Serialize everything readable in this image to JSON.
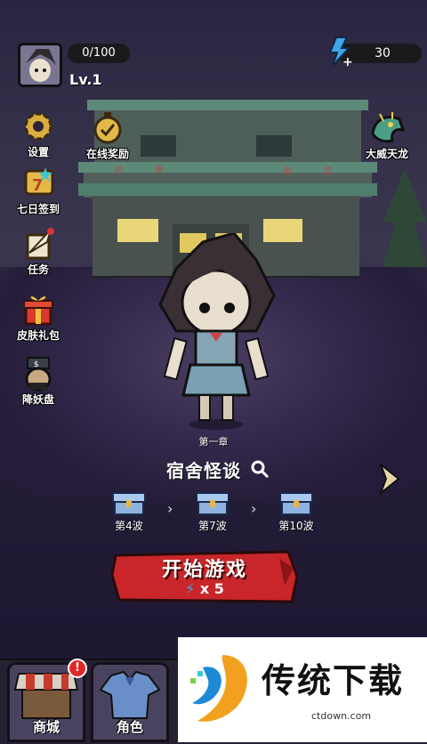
{
  "player": {
    "xp": "0/100",
    "level": "Lv.1"
  },
  "energy": {
    "value": "30"
  },
  "side_menu": {
    "settings": "设置",
    "checkin": "七日签到",
    "tasks": "任务",
    "skin_pack": "皮肤礼包",
    "demon_wheel": "降妖盘",
    "online_reward": "在线奖励",
    "dragon": "大威天龙"
  },
  "chapter": {
    "number": "第一章",
    "title": "宿舍怪谈",
    "waves": [
      "第4波",
      "第7波",
      "第10波"
    ]
  },
  "start_button": {
    "label": "开始游戏",
    "cost": "x 5"
  },
  "bottom_tabs": {
    "shop": "商城",
    "character": "角色",
    "shop_badge": "!"
  },
  "watermark": {
    "name": "传统下载",
    "url": "ctdown.com"
  },
  "building_sign": [
    "动",
    "奋",
    "务",
    "实"
  ]
}
